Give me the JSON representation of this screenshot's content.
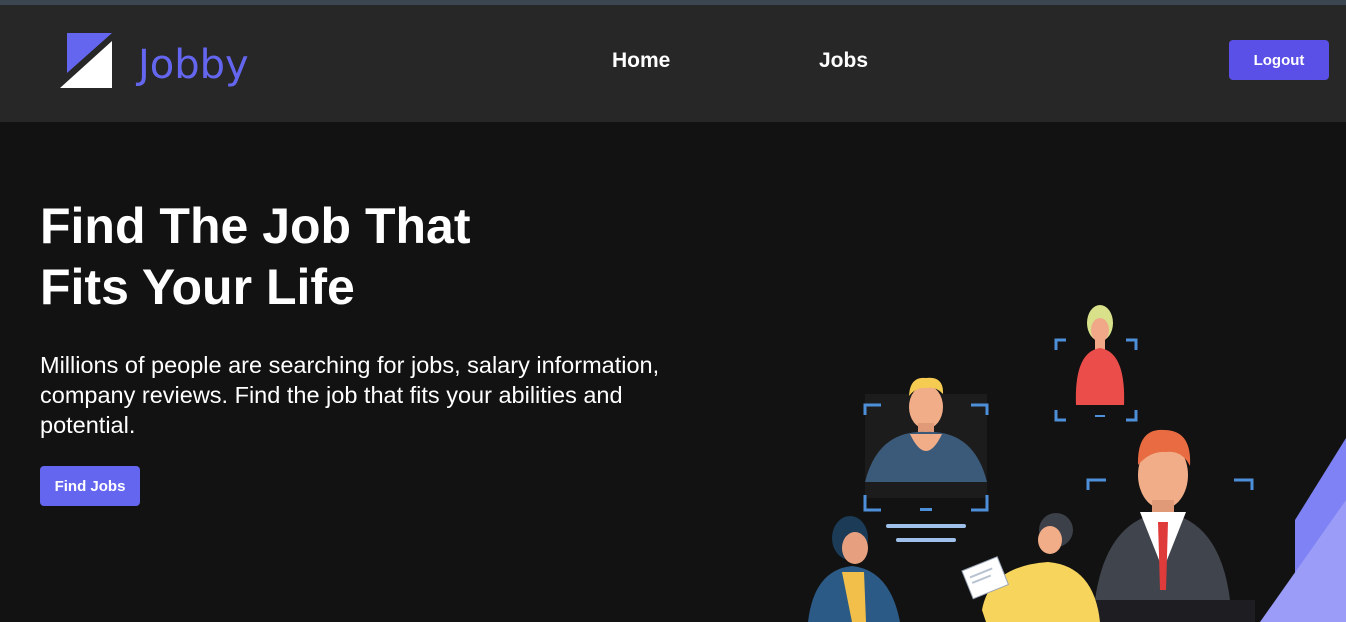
{
  "colors": {
    "accent": "#5a4fe6",
    "brand": "#6466f0",
    "navbar_bg": "#272727",
    "page_bg": "#121212"
  },
  "header": {
    "logo_icon": "jobby-logo-icon",
    "brand_name": "Jobby",
    "nav": [
      {
        "label": "Home"
      },
      {
        "label": "Jobs"
      }
    ],
    "logout_label": "Logout"
  },
  "hero": {
    "title_line1": "Find The Job That",
    "title_line2": "Fits Your Life",
    "description": "Millions of people are searching for jobs, salary information, company reviews. Find the job that fits your abilities and potential.",
    "cta_label": "Find Jobs",
    "illustration_icon": "job-search-people-illustration"
  }
}
